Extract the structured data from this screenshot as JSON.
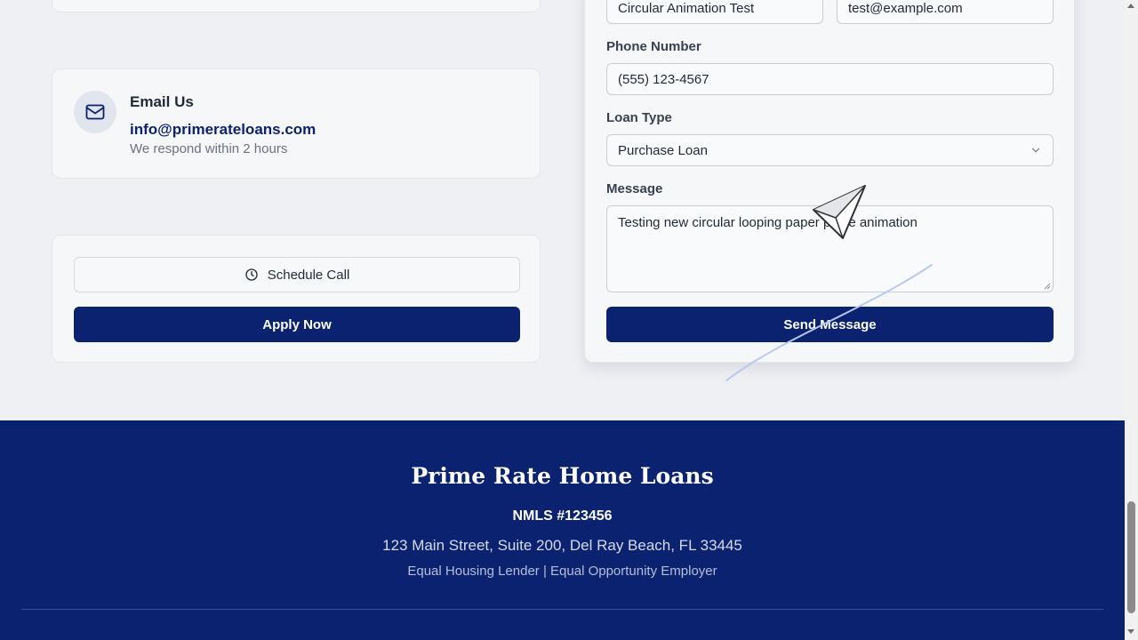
{
  "contact": {
    "email": {
      "title": "Email Us",
      "address": "info@primerateloans.com",
      "response_time": "We respond within 2 hours",
      "icon": "mail-icon"
    },
    "actions": {
      "schedule_label": "Schedule Call",
      "schedule_icon": "clock-icon",
      "apply_label": "Apply Now"
    }
  },
  "form": {
    "name_value": "Circular Animation Test",
    "email_value": "test@example.com",
    "phone_label": "Phone Number",
    "phone_value": "(555) 123-4567",
    "loan_type_label": "Loan Type",
    "loan_type_value": "Purchase Loan",
    "message_label": "Message",
    "message_value": "Testing new circular looping paper plane animation",
    "submit_label": "Send Message"
  },
  "footer": {
    "brand": "Prime Rate Home Loans",
    "nmls": "NMLS #123456",
    "address": "123 Main Street, Suite 200, Del Ray Beach, FL 33445",
    "equal": "Equal Housing Lender | Equal Opportunity Employer"
  },
  "colors": {
    "brand_navy": "#0b2270",
    "page_bg": "#eef0f4",
    "card_bg": "#f6f7f8"
  }
}
